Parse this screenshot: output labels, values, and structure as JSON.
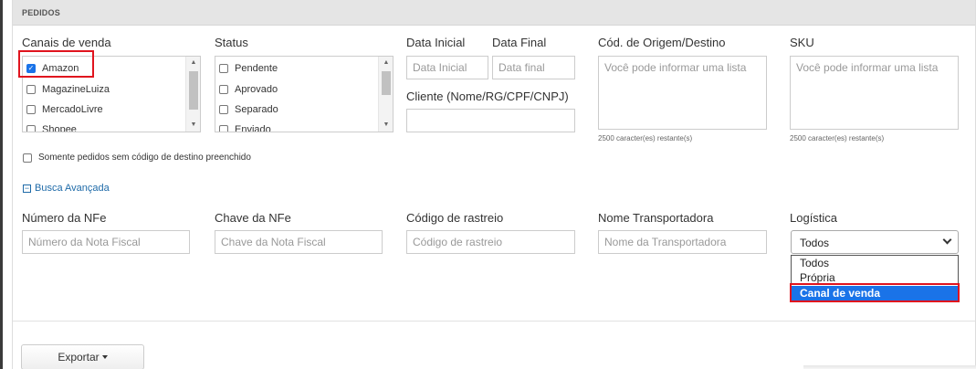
{
  "panel": {
    "title": "PEDIDOS"
  },
  "canais": {
    "label": "Canais de venda",
    "items": [
      {
        "label": "Amazon",
        "checked": true
      },
      {
        "label": "MagazineLuiza",
        "checked": false
      },
      {
        "label": "MercadoLivre",
        "checked": false
      },
      {
        "label": "Shopee",
        "checked": false
      }
    ]
  },
  "status": {
    "label": "Status",
    "items": [
      {
        "label": "Pendente",
        "checked": false
      },
      {
        "label": "Aprovado",
        "checked": false
      },
      {
        "label": "Separado",
        "checked": false
      },
      {
        "label": "Enviado",
        "checked": false
      }
    ]
  },
  "data_inicial": {
    "label": "Data Inicial",
    "placeholder": "Data Inicial"
  },
  "data_final": {
    "label": "Data Final",
    "placeholder": "Data final"
  },
  "cliente": {
    "label": "Cliente (Nome/RG/CPF/CNPJ)",
    "placeholder": ""
  },
  "origem_destino": {
    "label": "Cód. de Origem/Destino",
    "placeholder": "Você pode informar uma lista",
    "hint": "2500 caracter(es) restante(s)"
  },
  "sku": {
    "label": "SKU",
    "placeholder": "Você pode informar uma lista",
    "hint": "2500 caracter(es) restante(s)"
  },
  "somente_sem_destino": {
    "label": "Somente pedidos sem código de destino preenchido",
    "checked": false
  },
  "busca_avancada": {
    "label": "Busca Avançada",
    "icon": "minus-square-icon"
  },
  "nfe": {
    "label": "Número da NFe",
    "placeholder": "Número da Nota Fiscal"
  },
  "chave_nfe": {
    "label": "Chave da NFe",
    "placeholder": "Chave da Nota Fiscal"
  },
  "rastreio": {
    "label": "Código de rastreio",
    "placeholder": "Código de rastreio"
  },
  "transportadora": {
    "label": "Nome Transportadora",
    "placeholder": "Nome da Transportadora"
  },
  "logistica": {
    "label": "Logística",
    "selected": "Todos",
    "options": [
      "Todos",
      "Própria",
      "Canal de venda"
    ],
    "highlighted": "Canal de venda"
  },
  "exportar": {
    "label": "Exportar"
  },
  "colors": {
    "accent": "#1a73e8",
    "highlight_box": "#e0141e",
    "link": "#1e6aa8"
  }
}
